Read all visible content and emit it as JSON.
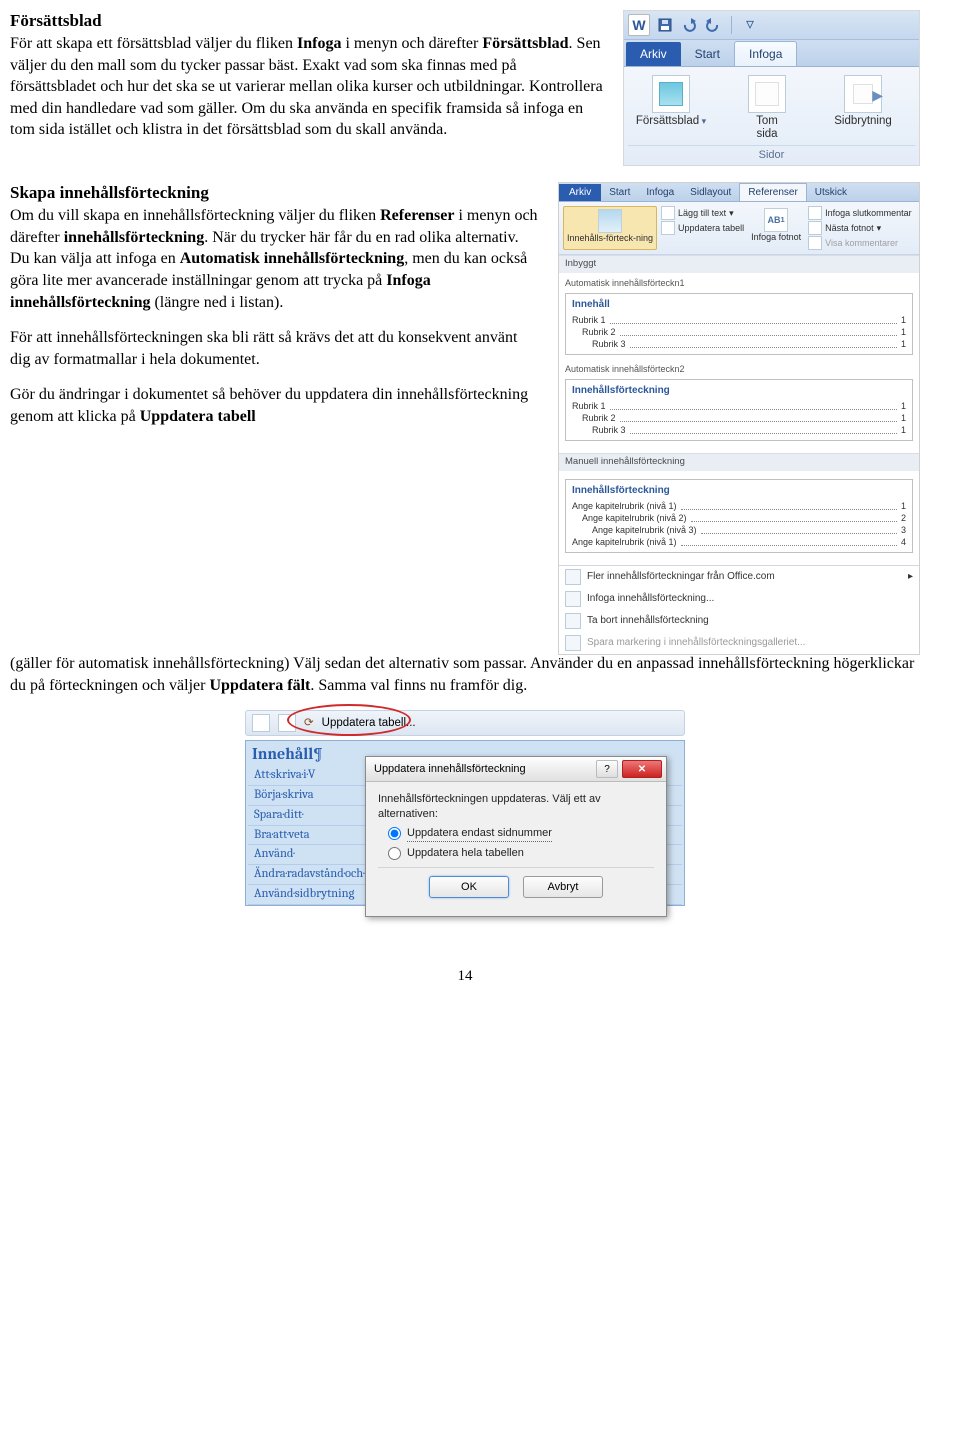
{
  "section1": {
    "heading": "Försättsblad",
    "p1a": "För att skapa ett försättsblad väljer du fliken ",
    "p1b": " i menyn och därefter ",
    "p1c": ". Sen väljer du den mall som du tycker passar bäst. Exakt vad som ska finnas med på försättsbladet och hur det ska se ut varierar mellan olika kurser och utbildningar. Kontrollera med din handledare vad som gäller. Om du ska använda en specifik framsida så infoga en tom sida istället och klistra in det försättsblad som du skall använda.",
    "bold1": "Infoga",
    "bold2": "Försättsblad"
  },
  "section2": {
    "heading": "Skapa innehållsförteckning",
    "p1a": "Om du vill skapa en innehållsförteckning väljer du fliken ",
    "p1b": " i menyn och därefter ",
    "p1c": ". När du trycker här får du en rad olika alternativ. Du kan välja att infoga en ",
    "p1d": ", men du kan också göra lite mer avancerade inställningar genom att trycka på ",
    "p1e": " (längre ned i listan).",
    "bold1": "Referenser",
    "bold2": "innehållsförteckning",
    "bold3": "Automatisk innehållsförteckning",
    "bold4": "Infoga innehållsförteckning",
    "p2": "För att innehållsförteckningen ska bli rätt så krävs det att du konsekvent använt dig av formatmallar i hela dokumentet.",
    "p3a": "Gör du ändringar i dokumentet så behöver du uppdatera din innehållsförteckning genom att klicka på ",
    "p3b": " (gäller för automatisk innehållsförteckning) Välj sedan det alternativ som passar. Använder du en anpassad innehållsförteckning högerklickar du på förteckningen och väljer ",
    "p3c": ". Samma val finns nu framför dig.",
    "bold5": "Uppdatera tabell",
    "bold6": "Uppdatera fält"
  },
  "fig1": {
    "word_logo": "W",
    "tab_file": "Arkiv",
    "tab_start": "Start",
    "tab_infoga": "Infoga",
    "item1": "Försättsblad",
    "item2a": "Tom",
    "item2b": "sida",
    "item3": "Sidbrytning",
    "group_caption": "Sidor"
  },
  "fig2": {
    "tab_file": "Arkiv",
    "tab_start": "Start",
    "tab_infoga": "Infoga",
    "tab_sidlayout": "Sidlayout",
    "tab_ref": "Referenser",
    "tab_utskick": "Utskick",
    "btn_toc": "Innehålls-förteck-ning",
    "mini_add": "Lägg till text",
    "mini_upd": "Uppdatera tabell",
    "btn_fn": "Infoga fotnot",
    "ab": "AB",
    "fn_end": "Infoga slutkommentar",
    "fn_next": "Nästa fotnot",
    "fn_show": "Visa kommentarer",
    "sec_builtin": "Inbyggt",
    "auto1_caption": "Automatisk innehållsförteckn1",
    "auto1_title": "Innehåll",
    "auto2_caption": "Automatisk innehållsförteckn2",
    "auto2_title": "Innehållsförteckning",
    "row1": "Rubrik 1",
    "row2": "Rubrik 2",
    "row3": "Rubrik 3",
    "pg1": "1",
    "sec_manual": "Manuell innehållsförteckning",
    "man_title": "Innehållsförteckning",
    "m1": "Ange kapitelrubrik (nivå 1)",
    "m2": "Ange kapitelrubrik (nivå 2)",
    "m3": "Ange kapitelrubrik (nivå 3)",
    "m4": "Ange kapitelrubrik (nivå 1)",
    "m_p1": "1",
    "m_p2": "2",
    "m_p3": "3",
    "m_p4": "4",
    "foot1": "Fler innehållsförteckningar från Office.com",
    "foot2": "Infoga innehållsförteckning...",
    "foot3": "Ta bort innehållsförteckning",
    "foot4": "Spara markering i innehållsförteckningsgalleriet..."
  },
  "fig3": {
    "tool_label": "Uppdatera tabell...",
    "toc_h": "Innehåll¶",
    "toc_rows": [
      "Att·skriva·i·V",
      "Börja·skriva",
      "Spara·ditt·",
      "Bra·att·veta",
      "Använd·",
      "Ändra·radavstånd·och·marginaler",
      "Använd·sidbrytning"
    ],
    "dlg_title": "Uppdatera innehållsförteckning",
    "dlg_msg": "Innehållsförteckningen uppdateras. Välj ett av alternativen:",
    "radio1": "Uppdatera endast sidnummer",
    "radio2": "Uppdatera hela tabellen",
    "ok": "OK",
    "cancel": "Avbryt",
    "help": "?",
    "close": "✕"
  },
  "page_number": "14"
}
